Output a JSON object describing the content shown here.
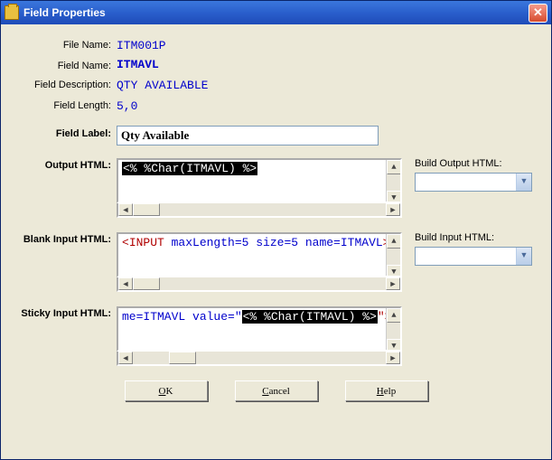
{
  "window": {
    "title": "Field Properties"
  },
  "props": {
    "file_name_label": "File Name:",
    "file_name": "ITM001P",
    "field_name_label": "Field Name:",
    "field_name": "ITMAVL",
    "field_desc_label": "Field Description:",
    "field_desc": "QTY AVAILABLE",
    "field_len_label": "Field Length:",
    "field_len": "5,0",
    "field_label_label": "Field Label:",
    "field_label": "Qty Available"
  },
  "output_html": {
    "label": "Output HTML:",
    "code_sel": "<% %Char(ITMAVL) %>",
    "build_label": "Build  Output HTML:"
  },
  "blank_input_html": {
    "label": "Blank Input HTML:",
    "tag_open": "<",
    "tag_name": "INPUT",
    "attrs": " maxLength=5 size=5 name=ITMAVL",
    "tag_close": ">",
    "build_label": "Build Input HTML:"
  },
  "sticky_input_html": {
    "label": "Sticky Input HTML:",
    "prefix_attrs": "me=ITMAVL value=\"",
    "sel": "<% %Char(ITMAVL) %>",
    "suffix": "\">"
  },
  "buttons": {
    "ok": "OK",
    "cancel": "Cancel",
    "help": "Help"
  }
}
